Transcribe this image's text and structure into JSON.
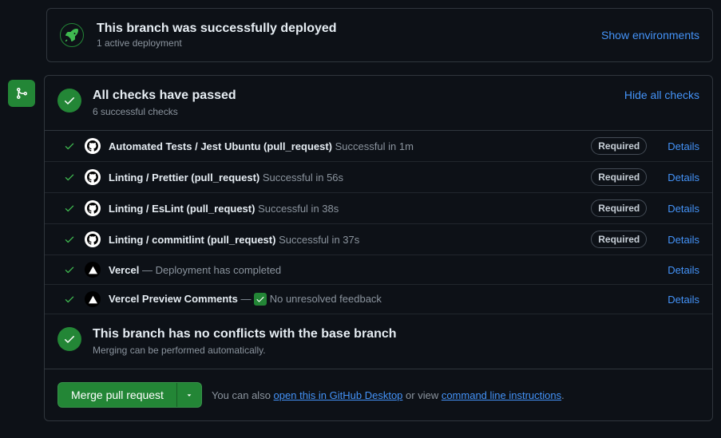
{
  "deploy": {
    "title": "This branch was successfully deployed",
    "sub": "1 active deployment",
    "show_env": "Show environments"
  },
  "checks_header": {
    "title": "All checks have passed",
    "sub": "6 successful checks",
    "toggle": "Hide all checks"
  },
  "checks": [
    {
      "name": "Automated Tests / Jest Ubuntu (pull_request)",
      "status": "Successful in 1m",
      "required": true,
      "avatar": "github",
      "details": "Details"
    },
    {
      "name": "Linting / Prettier (pull_request)",
      "status": "Successful in 56s",
      "required": true,
      "avatar": "github",
      "details": "Details"
    },
    {
      "name": "Linting / EsLint (pull_request)",
      "status": "Successful in 38s",
      "required": true,
      "avatar": "github",
      "details": "Details"
    },
    {
      "name": "Linting / commitlint (pull_request)",
      "status": "Successful in 37s",
      "required": true,
      "avatar": "github",
      "details": "Details"
    },
    {
      "name": "Vercel",
      "status": "Deployment has completed",
      "required": false,
      "avatar": "vercel",
      "dash": " — ",
      "details": "Details"
    },
    {
      "name": "Vercel Preview Comments",
      "status": "No unresolved feedback",
      "required": false,
      "avatar": "vercel",
      "dash": " — ",
      "checkbox": true,
      "details": "Details"
    }
  ],
  "conflicts": {
    "title": "This branch has no conflicts with the base branch",
    "sub": "Merging can be performed automatically."
  },
  "merge": {
    "button": "Merge pull request",
    "help_prefix": "You can also ",
    "link1": "open this in GitHub Desktop",
    "mid": " or view ",
    "link2": "command line instructions",
    "suffix": "."
  },
  "labels": {
    "required": "Required"
  }
}
